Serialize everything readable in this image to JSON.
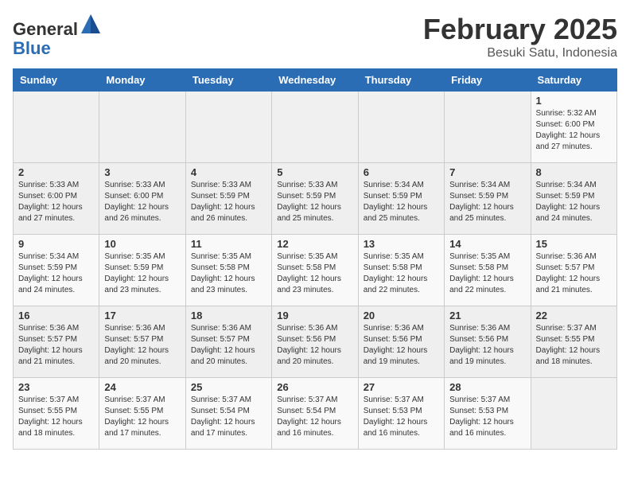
{
  "header": {
    "logo_general": "General",
    "logo_blue": "Blue",
    "month_title": "February 2025",
    "location": "Besuki Satu, Indonesia"
  },
  "days_of_week": [
    "Sunday",
    "Monday",
    "Tuesday",
    "Wednesday",
    "Thursday",
    "Friday",
    "Saturday"
  ],
  "weeks": [
    [
      {
        "day": "",
        "info": ""
      },
      {
        "day": "",
        "info": ""
      },
      {
        "day": "",
        "info": ""
      },
      {
        "day": "",
        "info": ""
      },
      {
        "day": "",
        "info": ""
      },
      {
        "day": "",
        "info": ""
      },
      {
        "day": "1",
        "info": "Sunrise: 5:32 AM\nSunset: 6:00 PM\nDaylight: 12 hours\nand 27 minutes."
      }
    ],
    [
      {
        "day": "2",
        "info": "Sunrise: 5:33 AM\nSunset: 6:00 PM\nDaylight: 12 hours\nand 27 minutes."
      },
      {
        "day": "3",
        "info": "Sunrise: 5:33 AM\nSunset: 6:00 PM\nDaylight: 12 hours\nand 26 minutes."
      },
      {
        "day": "4",
        "info": "Sunrise: 5:33 AM\nSunset: 5:59 PM\nDaylight: 12 hours\nand 26 minutes."
      },
      {
        "day": "5",
        "info": "Sunrise: 5:33 AM\nSunset: 5:59 PM\nDaylight: 12 hours\nand 25 minutes."
      },
      {
        "day": "6",
        "info": "Sunrise: 5:34 AM\nSunset: 5:59 PM\nDaylight: 12 hours\nand 25 minutes."
      },
      {
        "day": "7",
        "info": "Sunrise: 5:34 AM\nSunset: 5:59 PM\nDaylight: 12 hours\nand 25 minutes."
      },
      {
        "day": "8",
        "info": "Sunrise: 5:34 AM\nSunset: 5:59 PM\nDaylight: 12 hours\nand 24 minutes."
      }
    ],
    [
      {
        "day": "9",
        "info": "Sunrise: 5:34 AM\nSunset: 5:59 PM\nDaylight: 12 hours\nand 24 minutes."
      },
      {
        "day": "10",
        "info": "Sunrise: 5:35 AM\nSunset: 5:59 PM\nDaylight: 12 hours\nand 23 minutes."
      },
      {
        "day": "11",
        "info": "Sunrise: 5:35 AM\nSunset: 5:58 PM\nDaylight: 12 hours\nand 23 minutes."
      },
      {
        "day": "12",
        "info": "Sunrise: 5:35 AM\nSunset: 5:58 PM\nDaylight: 12 hours\nand 23 minutes."
      },
      {
        "day": "13",
        "info": "Sunrise: 5:35 AM\nSunset: 5:58 PM\nDaylight: 12 hours\nand 22 minutes."
      },
      {
        "day": "14",
        "info": "Sunrise: 5:35 AM\nSunset: 5:58 PM\nDaylight: 12 hours\nand 22 minutes."
      },
      {
        "day": "15",
        "info": "Sunrise: 5:36 AM\nSunset: 5:57 PM\nDaylight: 12 hours\nand 21 minutes."
      }
    ],
    [
      {
        "day": "16",
        "info": "Sunrise: 5:36 AM\nSunset: 5:57 PM\nDaylight: 12 hours\nand 21 minutes."
      },
      {
        "day": "17",
        "info": "Sunrise: 5:36 AM\nSunset: 5:57 PM\nDaylight: 12 hours\nand 20 minutes."
      },
      {
        "day": "18",
        "info": "Sunrise: 5:36 AM\nSunset: 5:57 PM\nDaylight: 12 hours\nand 20 minutes."
      },
      {
        "day": "19",
        "info": "Sunrise: 5:36 AM\nSunset: 5:56 PM\nDaylight: 12 hours\nand 20 minutes."
      },
      {
        "day": "20",
        "info": "Sunrise: 5:36 AM\nSunset: 5:56 PM\nDaylight: 12 hours\nand 19 minutes."
      },
      {
        "day": "21",
        "info": "Sunrise: 5:36 AM\nSunset: 5:56 PM\nDaylight: 12 hours\nand 19 minutes."
      },
      {
        "day": "22",
        "info": "Sunrise: 5:37 AM\nSunset: 5:55 PM\nDaylight: 12 hours\nand 18 minutes."
      }
    ],
    [
      {
        "day": "23",
        "info": "Sunrise: 5:37 AM\nSunset: 5:55 PM\nDaylight: 12 hours\nand 18 minutes."
      },
      {
        "day": "24",
        "info": "Sunrise: 5:37 AM\nSunset: 5:55 PM\nDaylight: 12 hours\nand 17 minutes."
      },
      {
        "day": "25",
        "info": "Sunrise: 5:37 AM\nSunset: 5:54 PM\nDaylight: 12 hours\nand 17 minutes."
      },
      {
        "day": "26",
        "info": "Sunrise: 5:37 AM\nSunset: 5:54 PM\nDaylight: 12 hours\nand 16 minutes."
      },
      {
        "day": "27",
        "info": "Sunrise: 5:37 AM\nSunset: 5:53 PM\nDaylight: 12 hours\nand 16 minutes."
      },
      {
        "day": "28",
        "info": "Sunrise: 5:37 AM\nSunset: 5:53 PM\nDaylight: 12 hours\nand 16 minutes."
      },
      {
        "day": "",
        "info": ""
      }
    ]
  ]
}
